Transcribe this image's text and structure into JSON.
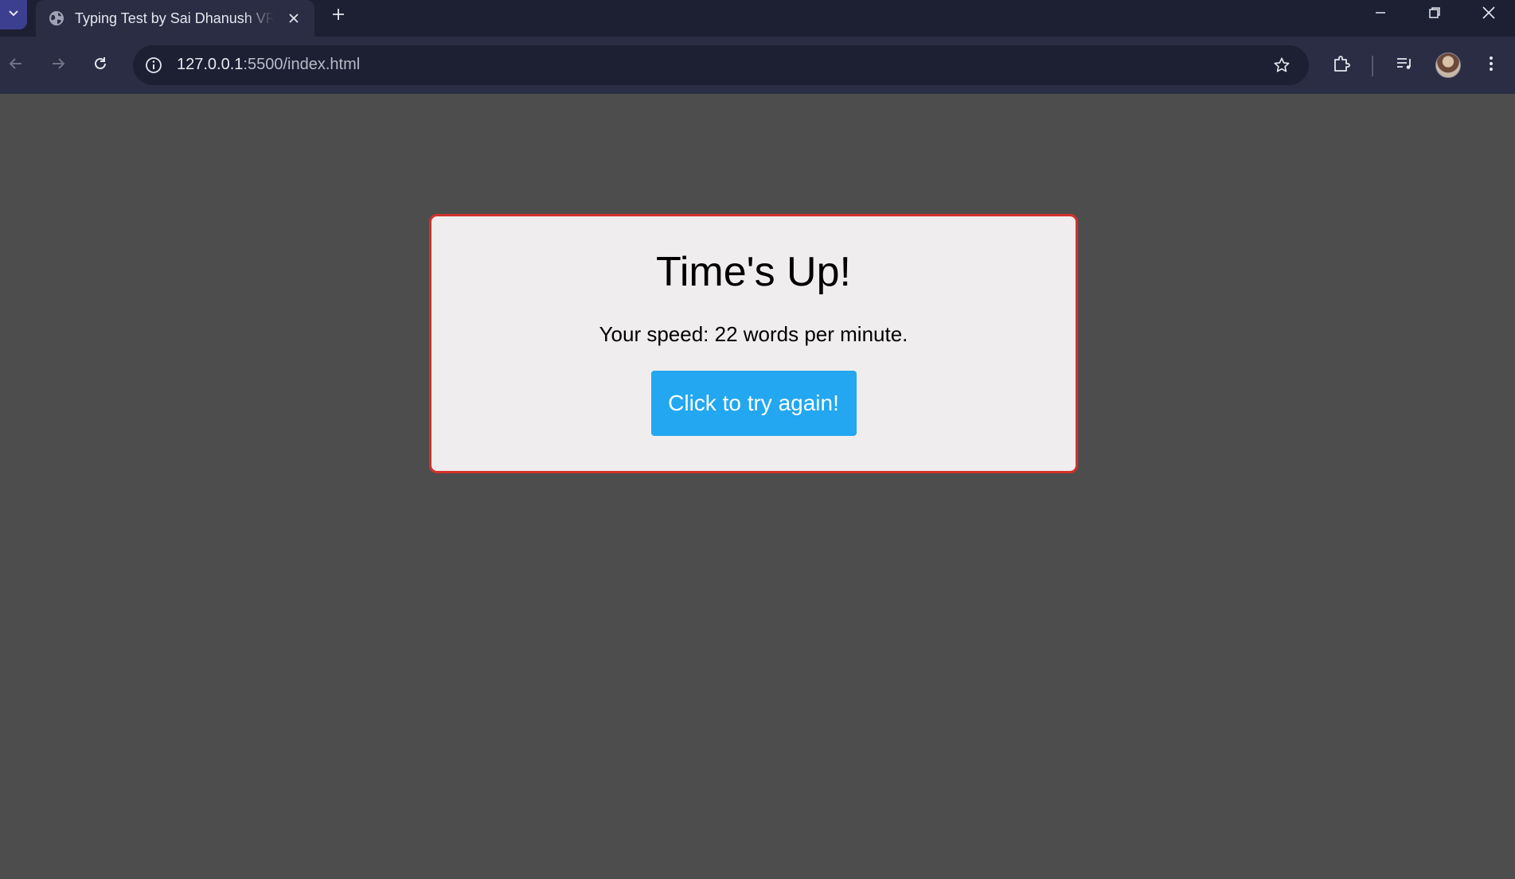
{
  "browser": {
    "tab": {
      "title": "Typing Test by Sai Dhanush VR",
      "favicon": "globe-icon"
    },
    "address_bar": {
      "host": "127.0.0.1",
      "path": ":5500/index.html"
    },
    "icons": {
      "tab_search": "chevron-down-icon",
      "close_tab": "close-icon",
      "new_tab": "plus-icon",
      "back": "arrow-left-icon",
      "forward": "arrow-right-icon",
      "reload": "reload-icon",
      "site_info": "info-icon",
      "bookmark": "star-icon",
      "extensions": "puzzle-icon",
      "media": "media-controls-icon",
      "menu": "kebab-menu-icon"
    }
  },
  "page": {
    "heading": "Time's Up!",
    "speed_text": "Your speed: 22 words per minute.",
    "retry_label": "Click to try again!"
  },
  "colors": {
    "page_background": "#4d4d4d",
    "card_background": "#efeded",
    "card_border": "#d3322b",
    "button": "#22a7f0"
  }
}
